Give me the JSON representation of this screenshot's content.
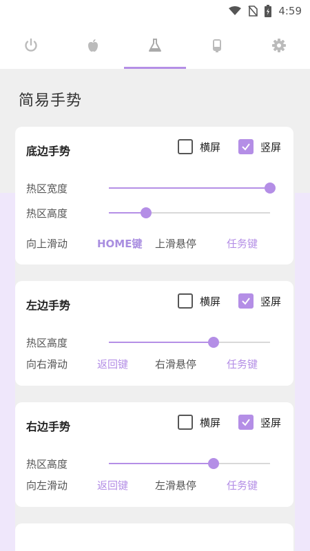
{
  "status": {
    "time": "4:59"
  },
  "tabs": [
    {
      "icon": "power-icon",
      "active": false
    },
    {
      "icon": "apple-icon",
      "active": false
    },
    {
      "icon": "flask-icon",
      "active": true
    },
    {
      "icon": "phone-icon",
      "active": false
    },
    {
      "icon": "gear-icon",
      "active": false
    }
  ],
  "page_title": "简易手势",
  "colors": {
    "accent": "#b48ee6",
    "background": "#efefef",
    "card": "#ffffff"
  },
  "bottom": {
    "title": "底边手势",
    "landscape": {
      "label": "横屏",
      "checked": false
    },
    "portrait": {
      "label": "竖屏",
      "checked": true
    },
    "hot_width_label": "热区宽度",
    "hot_width_value": 1.0,
    "hot_height_label": "热区高度",
    "hot_height_value": 0.23,
    "action_label": "向上滑动",
    "action_value": "HOME键",
    "hover_label": "上滑悬停",
    "hover_value": "任务键"
  },
  "left": {
    "title": "左边手势",
    "landscape": {
      "label": "横屏",
      "checked": false
    },
    "portrait": {
      "label": "竖屏",
      "checked": true
    },
    "hot_height_label": "热区高度",
    "hot_height_value": 0.65,
    "action_label": "向右滑动",
    "action_value": "返回键",
    "hover_label": "右滑悬停",
    "hover_value": "任务键"
  },
  "right": {
    "title": "右边手势",
    "landscape": {
      "label": "横屏",
      "checked": false
    },
    "portrait": {
      "label": "竖屏",
      "checked": true
    },
    "hot_height_label": "热区高度",
    "hot_height_value": 0.65,
    "action_label": "向左滑动",
    "action_value": "返回键",
    "hover_label": "左滑悬停",
    "hover_value": "任务键"
  }
}
